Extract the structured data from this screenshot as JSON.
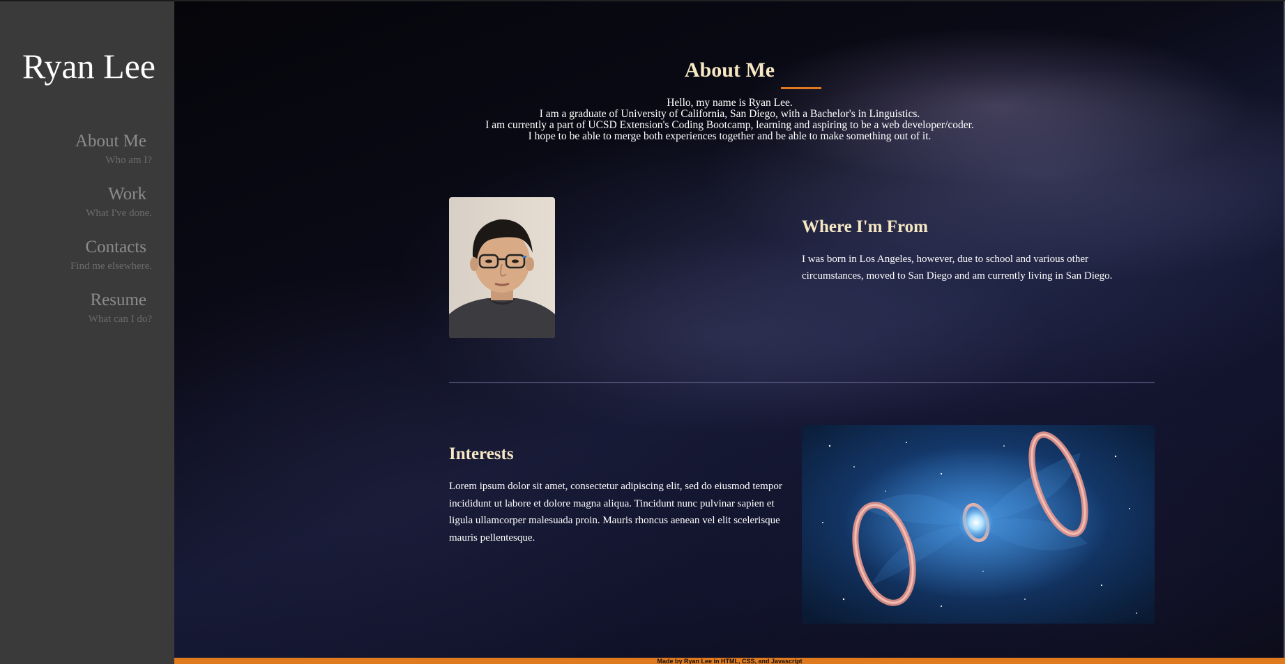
{
  "sidebar": {
    "brand": "Ryan Lee",
    "items": [
      {
        "label": "About Me",
        "sub": "Who am I?"
      },
      {
        "label": "Work",
        "sub": "What I've done."
      },
      {
        "label": "Contacts",
        "sub": "Find me elsewhere."
      },
      {
        "label": "Resume",
        "sub": "What can I do?"
      }
    ]
  },
  "about": {
    "title": "About Me",
    "lines": [
      "Hello, my name is Ryan Lee.",
      "I am a graduate of University of California, San Diego, with a Bachelor's in Linguistics.",
      "I am currently a part of UCSD Extension's Coding Bootcamp, learning and aspiring to be a web developer/coder.",
      "I hope to be able to merge both experiences together and be able to make something out of it."
    ]
  },
  "from": {
    "title": "Where I'm From",
    "text": "I was born in Los Angeles, however, due to school and various other circumstances, moved to San Diego and am currently living in San Diego."
  },
  "interests": {
    "title": "Interests",
    "text": "Lorem ipsum dolor sit amet, consectetur adipiscing elit, sed do eiusmod tempor incididunt ut labore et dolore magna aliqua. Tincidunt nunc pulvinar sapien et ligula ullamcorper malesuada proin. Mauris rhoncus aenean vel elit scelerisque mauris pellentesque."
  },
  "footer": {
    "text": "Made by Ryan Lee in HTML, CSS, and Javascript"
  },
  "colors": {
    "accent": "#e07a1f",
    "heading": "#f7e8c4",
    "sidebar": "#3a3a3a"
  }
}
